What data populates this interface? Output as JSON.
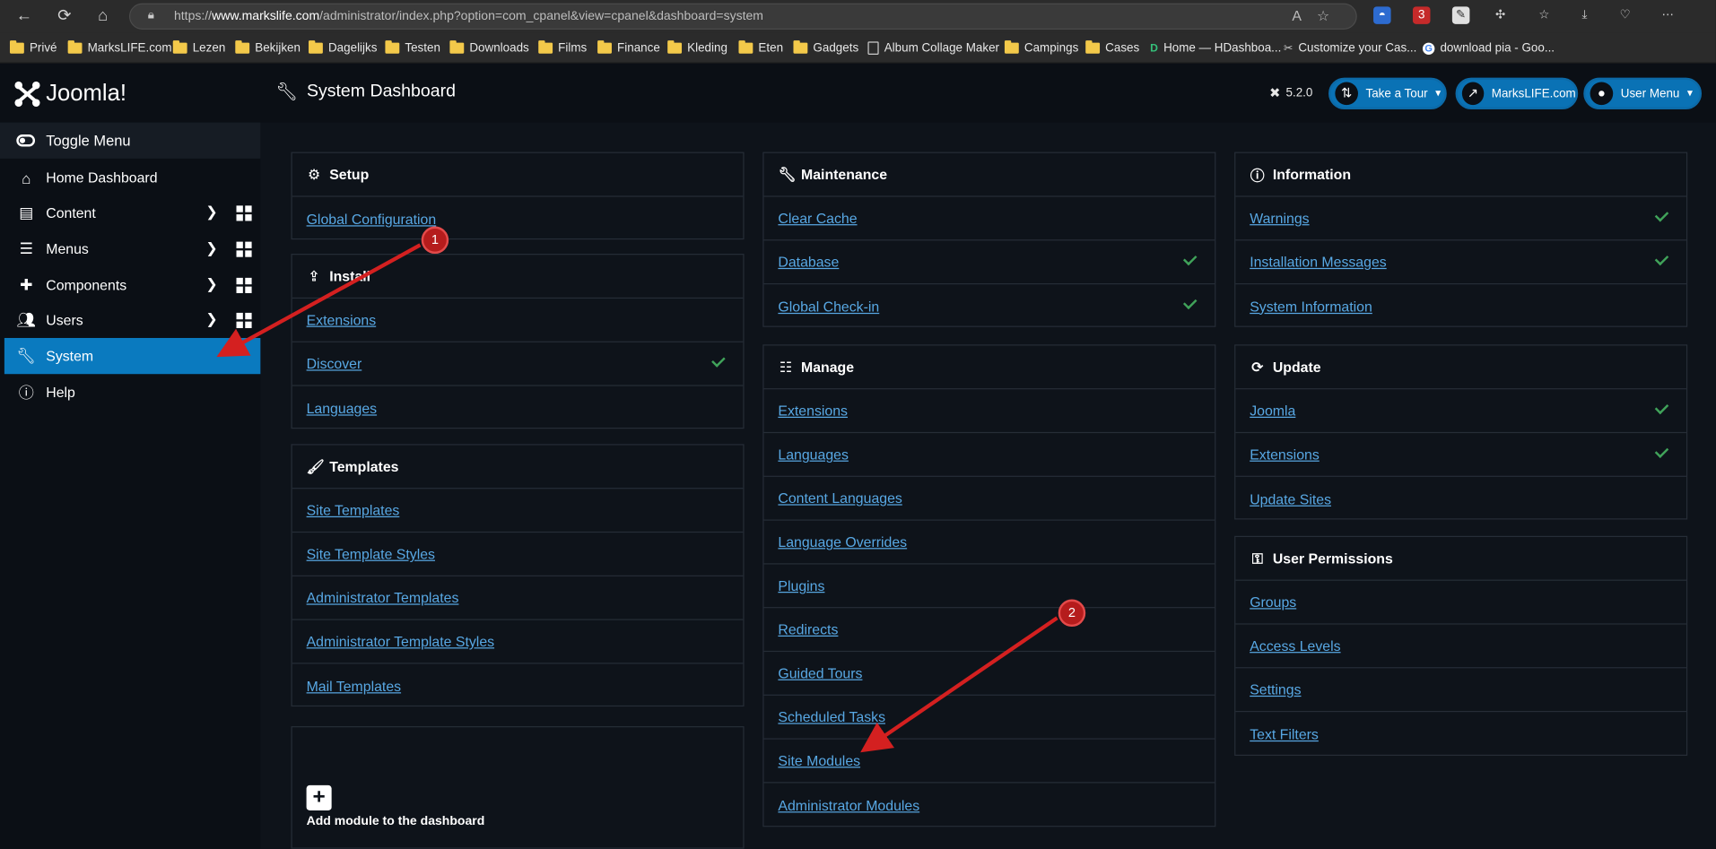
{
  "browser": {
    "url_prefix": "https://",
    "url_host": "www.markslife.com",
    "url_path": "/administrator/index.php?option=com_cpanel&view=cpanel&dashboard=system",
    "ext_badge": "3",
    "bookmarks": [
      "Privé",
      "MarksLIFE.com",
      "Lezen",
      "Bekijken",
      "Dagelijks",
      "Testen",
      "Downloads",
      "Films",
      "Finance",
      "Kleding",
      "Eten",
      "Gadgets",
      "Album Collage Maker",
      "Campings",
      "Cases",
      "Home — HDashboa...",
      "Customize your Cas...",
      "download pia - Goo..."
    ]
  },
  "header": {
    "logo_text": "Joomla!",
    "title": "System Dashboard",
    "version": "5.2.0",
    "tour_label": "Take a Tour",
    "site_label": "MarksLIFE.com",
    "user_label": "User Menu"
  },
  "sidebar": {
    "toggle_label": "Toggle Menu",
    "items": [
      {
        "label": "Home Dashboard",
        "icon": "home-icon"
      },
      {
        "label": "Content",
        "icon": "file-icon"
      },
      {
        "label": "Menus",
        "icon": "list-icon"
      },
      {
        "label": "Components",
        "icon": "puzzle-icon"
      },
      {
        "label": "Users",
        "icon": "users-icon"
      },
      {
        "label": "System",
        "icon": "wrench-icon"
      },
      {
        "label": "Help",
        "icon": "info-icon"
      }
    ]
  },
  "cards": {
    "setup": {
      "title": "Setup",
      "items": [
        "Global Configuration"
      ]
    },
    "install": {
      "title": "Install",
      "items": [
        "Extensions",
        "Discover",
        "Languages"
      ]
    },
    "templates": {
      "title": "Templates",
      "items": [
        "Site Templates",
        "Site Template Styles",
        "Administrator Templates",
        "Administrator Template Styles",
        "Mail Templates"
      ]
    },
    "maintenance": {
      "title": "Maintenance",
      "items": [
        "Clear Cache",
        "Database",
        "Global Check-in"
      ]
    },
    "manage": {
      "title": "Manage",
      "items": [
        "Extensions",
        "Languages",
        "Content Languages",
        "Language Overrides",
        "Plugins",
        "Redirects",
        "Guided Tours",
        "Scheduled Tasks",
        "Site Modules",
        "Administrator Modules"
      ]
    },
    "information": {
      "title": "Information",
      "items": [
        "Warnings",
        "Installation Messages",
        "System Information"
      ]
    },
    "update": {
      "title": "Update",
      "items": [
        "Joomla",
        "Extensions",
        "Update Sites"
      ]
    },
    "permissions": {
      "title": "User Permissions",
      "items": [
        "Groups",
        "Access Levels",
        "Settings",
        "Text Filters"
      ]
    }
  },
  "add_module_label": "Add module to the dashboard",
  "annotations": {
    "badge1": "1",
    "badge2": "2"
  },
  "colors": {
    "accent": "#0a7abf",
    "link": "#58a8e4",
    "check": "#40a35a",
    "annotation": "#d42020"
  }
}
